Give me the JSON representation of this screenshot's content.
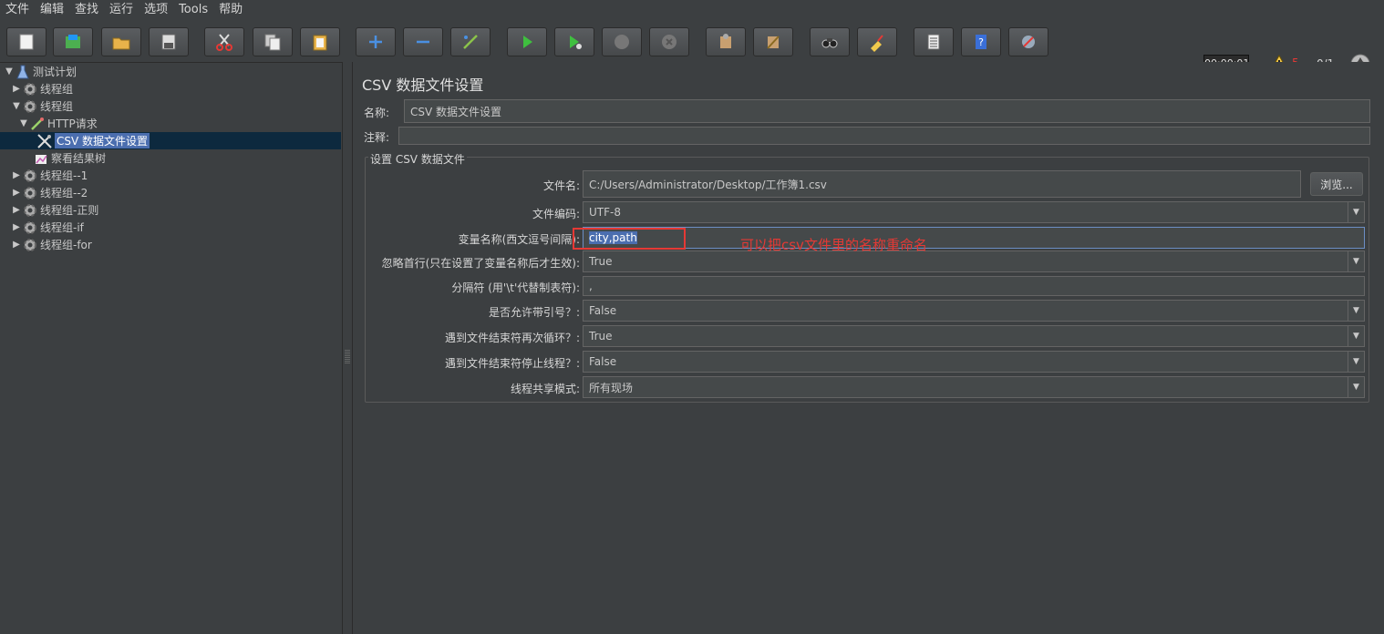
{
  "menu": [
    "文件",
    "编辑",
    "查找",
    "运行",
    "选项",
    "Tools",
    "帮助"
  ],
  "toolbar": {
    "timer": "00:00:01",
    "warning_count": "5",
    "thread_ratio": "0/1",
    "icons": [
      "new-icon",
      "templates-icon",
      "open-icon",
      "save-icon",
      "cut-icon",
      "copy-icon",
      "paste-icon",
      "expand-icon",
      "collapse-icon",
      "toggle-icon",
      "start-icon",
      "start-no-pause-icon",
      "stop-icon",
      "shutdown-icon",
      "clear-icon",
      "clear-all-icon",
      "search-icon",
      "reset-search-icon",
      "function-helper-icon",
      "help-icon",
      "remote-icon"
    ]
  },
  "tree": {
    "items": [
      {
        "label": "测试计划",
        "level": 0,
        "expanded": true
      },
      {
        "label": "线程组",
        "level": 1,
        "expanded": false
      },
      {
        "label": "线程组",
        "level": 1,
        "expanded": true
      },
      {
        "label": "HTTP请求",
        "level": 2,
        "expanded": true
      },
      {
        "label": "CSV 数据文件设置",
        "level": 3,
        "selected": true
      },
      {
        "label": "察看结果树",
        "level": 3
      },
      {
        "label": "线程组--1",
        "level": 1,
        "expanded": false
      },
      {
        "label": "线程组--2",
        "level": 1,
        "expanded": false
      },
      {
        "label": "线程组-正则",
        "level": 1,
        "expanded": false
      },
      {
        "label": "线程组-if",
        "level": 1,
        "expanded": false
      },
      {
        "label": "线程组-for",
        "level": 1,
        "expanded": false
      }
    ]
  },
  "panel": {
    "title": "CSV 数据文件设置",
    "name_label": "名称:",
    "name_value": "CSV 数据文件设置",
    "comment_label": "注释:",
    "comment_value": "",
    "group_title": "设置 CSV 数据文件",
    "filename_label": "文件名:",
    "filename_value": "C:/Users/Administrator/Desktop/工作簿1.csv",
    "browse_label": "浏览...",
    "encoding_label": "文件编码:",
    "encoding_value": "UTF-8",
    "varnames_label": "变量名称(西文逗号间隔):",
    "varnames_value": "city,path",
    "ignore_first_label": "忽略首行(只在设置了变量名称后才生效):",
    "ignore_first_value": "True",
    "delimiter_label": "分隔符 (用'\\t'代替制表符):",
    "delimiter_value": ",",
    "quoted_label": "是否允许带引号？:",
    "quoted_value": "False",
    "recycle_label": "遇到文件结束符再次循环？:",
    "recycle_value": "True",
    "stop_thread_label": "遇到文件结束符停止线程？:",
    "stop_thread_value": "False",
    "sharing_label": "线程共享模式:",
    "sharing_value": "所有现场"
  },
  "annotation": {
    "text": "可以把csv文件里的名称重命名",
    "color": "#e53935"
  }
}
